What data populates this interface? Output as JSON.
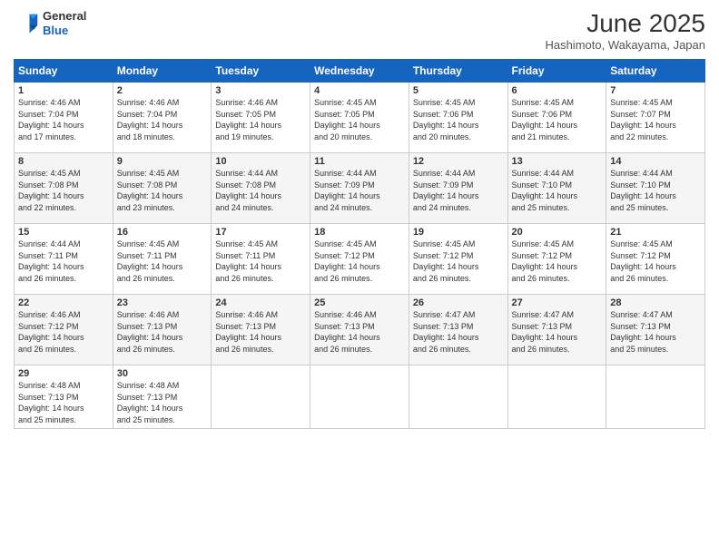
{
  "header": {
    "logo_line1": "General",
    "logo_line2": "Blue",
    "title": "June 2025",
    "subtitle": "Hashimoto, Wakayama, Japan"
  },
  "weekdays": [
    "Sunday",
    "Monday",
    "Tuesday",
    "Wednesday",
    "Thursday",
    "Friday",
    "Saturday"
  ],
  "weeks": [
    [
      {
        "day": "1",
        "info": "Sunrise: 4:46 AM\nSunset: 7:04 PM\nDaylight: 14 hours\nand 17 minutes."
      },
      {
        "day": "2",
        "info": "Sunrise: 4:46 AM\nSunset: 7:04 PM\nDaylight: 14 hours\nand 18 minutes."
      },
      {
        "day": "3",
        "info": "Sunrise: 4:46 AM\nSunset: 7:05 PM\nDaylight: 14 hours\nand 19 minutes."
      },
      {
        "day": "4",
        "info": "Sunrise: 4:45 AM\nSunset: 7:05 PM\nDaylight: 14 hours\nand 20 minutes."
      },
      {
        "day": "5",
        "info": "Sunrise: 4:45 AM\nSunset: 7:06 PM\nDaylight: 14 hours\nand 20 minutes."
      },
      {
        "day": "6",
        "info": "Sunrise: 4:45 AM\nSunset: 7:06 PM\nDaylight: 14 hours\nand 21 minutes."
      },
      {
        "day": "7",
        "info": "Sunrise: 4:45 AM\nSunset: 7:07 PM\nDaylight: 14 hours\nand 22 minutes."
      }
    ],
    [
      {
        "day": "8",
        "info": "Sunrise: 4:45 AM\nSunset: 7:08 PM\nDaylight: 14 hours\nand 22 minutes."
      },
      {
        "day": "9",
        "info": "Sunrise: 4:45 AM\nSunset: 7:08 PM\nDaylight: 14 hours\nand 23 minutes."
      },
      {
        "day": "10",
        "info": "Sunrise: 4:44 AM\nSunset: 7:08 PM\nDaylight: 14 hours\nand 24 minutes."
      },
      {
        "day": "11",
        "info": "Sunrise: 4:44 AM\nSunset: 7:09 PM\nDaylight: 14 hours\nand 24 minutes."
      },
      {
        "day": "12",
        "info": "Sunrise: 4:44 AM\nSunset: 7:09 PM\nDaylight: 14 hours\nand 24 minutes."
      },
      {
        "day": "13",
        "info": "Sunrise: 4:44 AM\nSunset: 7:10 PM\nDaylight: 14 hours\nand 25 minutes."
      },
      {
        "day": "14",
        "info": "Sunrise: 4:44 AM\nSunset: 7:10 PM\nDaylight: 14 hours\nand 25 minutes."
      }
    ],
    [
      {
        "day": "15",
        "info": "Sunrise: 4:44 AM\nSunset: 7:11 PM\nDaylight: 14 hours\nand 26 minutes."
      },
      {
        "day": "16",
        "info": "Sunrise: 4:45 AM\nSunset: 7:11 PM\nDaylight: 14 hours\nand 26 minutes."
      },
      {
        "day": "17",
        "info": "Sunrise: 4:45 AM\nSunset: 7:11 PM\nDaylight: 14 hours\nand 26 minutes."
      },
      {
        "day": "18",
        "info": "Sunrise: 4:45 AM\nSunset: 7:12 PM\nDaylight: 14 hours\nand 26 minutes."
      },
      {
        "day": "19",
        "info": "Sunrise: 4:45 AM\nSunset: 7:12 PM\nDaylight: 14 hours\nand 26 minutes."
      },
      {
        "day": "20",
        "info": "Sunrise: 4:45 AM\nSunset: 7:12 PM\nDaylight: 14 hours\nand 26 minutes."
      },
      {
        "day": "21",
        "info": "Sunrise: 4:45 AM\nSunset: 7:12 PM\nDaylight: 14 hours\nand 26 minutes."
      }
    ],
    [
      {
        "day": "22",
        "info": "Sunrise: 4:46 AM\nSunset: 7:12 PM\nDaylight: 14 hours\nand 26 minutes."
      },
      {
        "day": "23",
        "info": "Sunrise: 4:46 AM\nSunset: 7:13 PM\nDaylight: 14 hours\nand 26 minutes."
      },
      {
        "day": "24",
        "info": "Sunrise: 4:46 AM\nSunset: 7:13 PM\nDaylight: 14 hours\nand 26 minutes."
      },
      {
        "day": "25",
        "info": "Sunrise: 4:46 AM\nSunset: 7:13 PM\nDaylight: 14 hours\nand 26 minutes."
      },
      {
        "day": "26",
        "info": "Sunrise: 4:47 AM\nSunset: 7:13 PM\nDaylight: 14 hours\nand 26 minutes."
      },
      {
        "day": "27",
        "info": "Sunrise: 4:47 AM\nSunset: 7:13 PM\nDaylight: 14 hours\nand 26 minutes."
      },
      {
        "day": "28",
        "info": "Sunrise: 4:47 AM\nSunset: 7:13 PM\nDaylight: 14 hours\nand 25 minutes."
      }
    ],
    [
      {
        "day": "29",
        "info": "Sunrise: 4:48 AM\nSunset: 7:13 PM\nDaylight: 14 hours\nand 25 minutes."
      },
      {
        "day": "30",
        "info": "Sunrise: 4:48 AM\nSunset: 7:13 PM\nDaylight: 14 hours\nand 25 minutes."
      },
      null,
      null,
      null,
      null,
      null
    ]
  ]
}
